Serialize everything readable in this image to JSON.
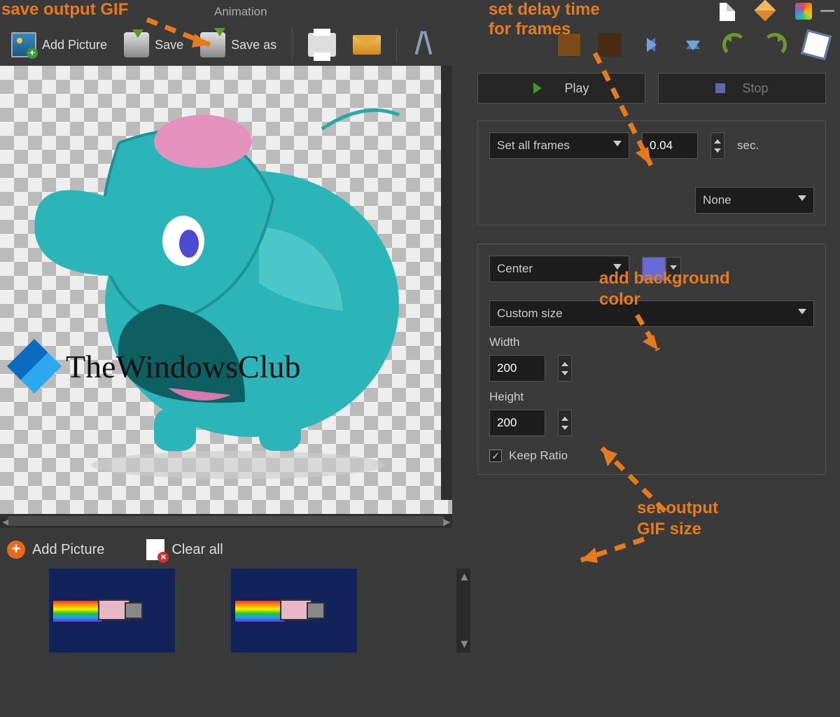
{
  "annotations": {
    "save_output_gif": "save output GIF",
    "set_delay_time": "set delay time",
    "for_frames": "for frames",
    "add_bg_1": "add background",
    "add_bg_2": "color",
    "set_output_1": "set output",
    "set_output_2": "GIF size"
  },
  "menu": {
    "animation": "Animation"
  },
  "toolbar": {
    "add_picture": "Add Picture",
    "save": "Save",
    "save_as": "Save as"
  },
  "frames": {
    "add_picture": "Add Picture",
    "clear_all": "Clear all"
  },
  "controls": {
    "play": "Play",
    "stop": "Stop",
    "set_all_frames": "Set all frames",
    "delay_value": "0.04",
    "sec_label": "sec.",
    "transition": "None",
    "align": "Center",
    "size_mode": "Custom size",
    "width_label": "Width",
    "width_value": "200",
    "height_label": "Height",
    "height_value": "200",
    "keep_ratio": "Keep Ratio"
  },
  "watermark": {
    "text": "TheWindowsClub"
  }
}
